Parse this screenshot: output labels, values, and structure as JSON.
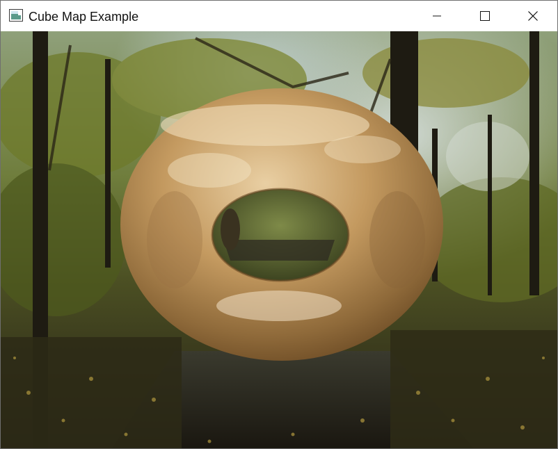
{
  "window": {
    "title": "Cube Map Example",
    "controls": {
      "minimize_icon": "minimize-icon",
      "maximize_icon": "maximize-icon",
      "close_icon": "close-icon"
    }
  },
  "scene": {
    "background": "autumn forest path",
    "object": "reflective torus",
    "colors": {
      "torus_light": "#e6c89a",
      "torus_mid": "#b38a55",
      "torus_dark": "#6b4a24",
      "foliage": "#5a6a28",
      "sky": "#c9d8e0",
      "ground": "#2a2418"
    }
  }
}
